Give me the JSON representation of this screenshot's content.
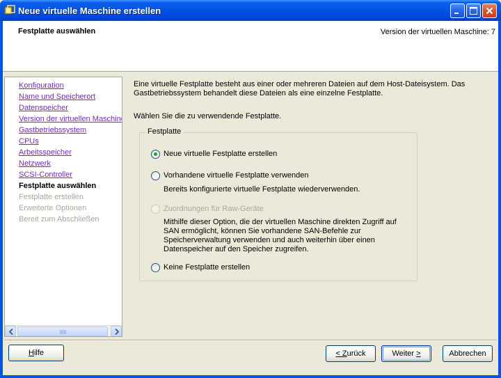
{
  "window": {
    "title": "Neue virtuelle Maschine erstellen",
    "title_icon": "vmware-vm-icon"
  },
  "header": {
    "step_title": "Festplatte auswählen",
    "version_text": "Version der virtuellen Maschine: 7"
  },
  "nav": {
    "items": [
      {
        "label": "Konfiguration",
        "state": "link"
      },
      {
        "label": "Name und Speicherort",
        "state": "link"
      },
      {
        "label": "Datenspeicher",
        "state": "link"
      },
      {
        "label": "Version der virtuellen Maschine",
        "state": "link"
      },
      {
        "label": "Gastbetriebssystem",
        "state": "link"
      },
      {
        "label": "CPUs",
        "state": "link"
      },
      {
        "label": "Arbeitsspeicher",
        "state": "link"
      },
      {
        "label": "Netzwerk",
        "state": "link"
      },
      {
        "label": "SCSI-Controller",
        "state": "link"
      },
      {
        "label": "Festplatte auswählen",
        "state": "current"
      },
      {
        "label": "Festplatte erstellen",
        "state": "disabled"
      },
      {
        "label": "Erweiterte Optionen",
        "state": "disabled"
      },
      {
        "label": "Bereit zum Abschließen",
        "state": "disabled"
      }
    ]
  },
  "main": {
    "intro_line1": "Eine virtuelle Festplatte besteht aus einer oder mehreren Dateien auf dem Host-Dateisystem. Das",
    "intro_line2": "Gastbetriebssystem behandelt diese Dateien als eine einzelne Festplatte.",
    "select_label": "Wählen Sie die zu verwendende Festplatte.",
    "group_label": "Festplatte",
    "options": [
      {
        "label": "Neue virtuelle Festplatte erstellen",
        "selected": true,
        "enabled": true
      },
      {
        "label": "Vorhandene virtuelle Festplatte verwenden",
        "selected": false,
        "enabled": true,
        "description": [
          "Bereits konfigurierte virtuelle Festplatte wiederverwenden."
        ]
      },
      {
        "label": "Zuordnungen für Raw-Geräte",
        "selected": false,
        "enabled": false,
        "description": [
          "Mithilfe dieser Option, die der virtuellen Maschine direkten Zugriff auf",
          "SAN ermöglicht, können Sie vorhandene SAN-Befehle zur",
          "Speicherverwaltung verwenden und auch weiterhin über einen",
          "Datenspeicher auf den Speicher zugreifen."
        ]
      },
      {
        "label": "Keine Festplatte erstellen",
        "selected": false,
        "enabled": true
      }
    ]
  },
  "footer": {
    "help": {
      "pre": "",
      "key": "H",
      "post": "ilfe"
    },
    "back": {
      "pre": "< ",
      "key": "Z",
      "post": "urück"
    },
    "next": {
      "pre": "Weiter ",
      "key": ">",
      "post": ""
    },
    "cancel": {
      "label": "Abbrechen"
    }
  },
  "colors": {
    "titlebar": "#0055e5",
    "nav_link": "#7a2fb3",
    "nav_disabled": "#aca899",
    "radio_dot": "#21a121"
  }
}
